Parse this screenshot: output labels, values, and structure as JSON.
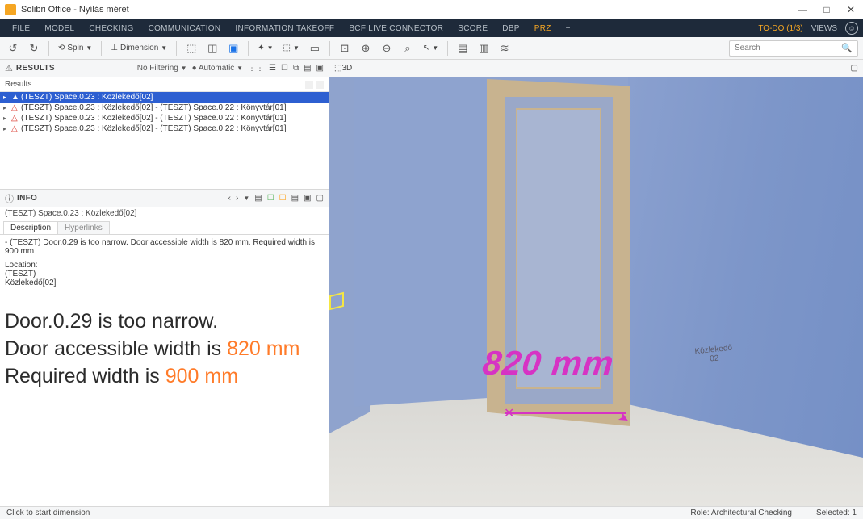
{
  "window": {
    "title": "Solibri Office - Nyílás méret",
    "min": "—",
    "max": "□",
    "close": "✕"
  },
  "menu": {
    "items": [
      "FILE",
      "MODEL",
      "CHECKING",
      "COMMUNICATION",
      "INFORMATION TAKEOFF",
      "BCF LIVE CONNECTOR",
      "SCORE",
      "DBP",
      "PRZ",
      "+"
    ],
    "active_index": 8,
    "todo": "TO-DO (1/3)",
    "views": "VIEWS"
  },
  "toolbar": {
    "spin_label": "Spin",
    "dimension_label": "Dimension",
    "search_placeholder": "Search"
  },
  "results": {
    "panel_title": "RESULTS",
    "filter_label": "No Filtering",
    "mode_label": "Automatic",
    "col_label": "Results",
    "rows": [
      {
        "text": "(TESZT) Space.0.23 : Közlekedő[02]",
        "selected": true
      },
      {
        "text": "(TESZT) Space.0.23 : Közlekedő[02] - (TESZT) Space.0.22 : Könyvtár[01]",
        "selected": false
      },
      {
        "text": "(TESZT) Space.0.23 : Közlekedő[02] - (TESZT) Space.0.22 : Könyvtár[01]",
        "selected": false
      },
      {
        "text": "(TESZT) Space.0.23 : Közlekedő[02] - (TESZT) Space.0.22 : Könyvtár[01]",
        "selected": false
      }
    ]
  },
  "info": {
    "panel_title": "INFO",
    "subject": "(TESZT) Space.0.23 : Közlekedő[02]",
    "tabs": {
      "desc": "Description",
      "hyper": "Hyperlinks"
    },
    "desc_line": "- (TESZT) Door.0.29 is too narrow. Door accessible width is 820 mm. Required width is 900 mm",
    "loc_header": "Location:",
    "loc_1": "(TESZT)",
    "loc_2": "Közlekedő[02]",
    "big": {
      "l1a": "Door.0.29 is too narrow.",
      "l2a": "Door accessible width is ",
      "l2b": "820 mm",
      "l3a": "Required width is ",
      "l3b": "900 mm"
    }
  },
  "view3d": {
    "panel_title": "3D",
    "dimension_text": "820 mm",
    "room_label_1": "Közlekedő",
    "room_label_2": "02"
  },
  "status": {
    "left": "Click to start dimension",
    "role": "Role: Architectural Checking",
    "selected": "Selected: 1"
  }
}
